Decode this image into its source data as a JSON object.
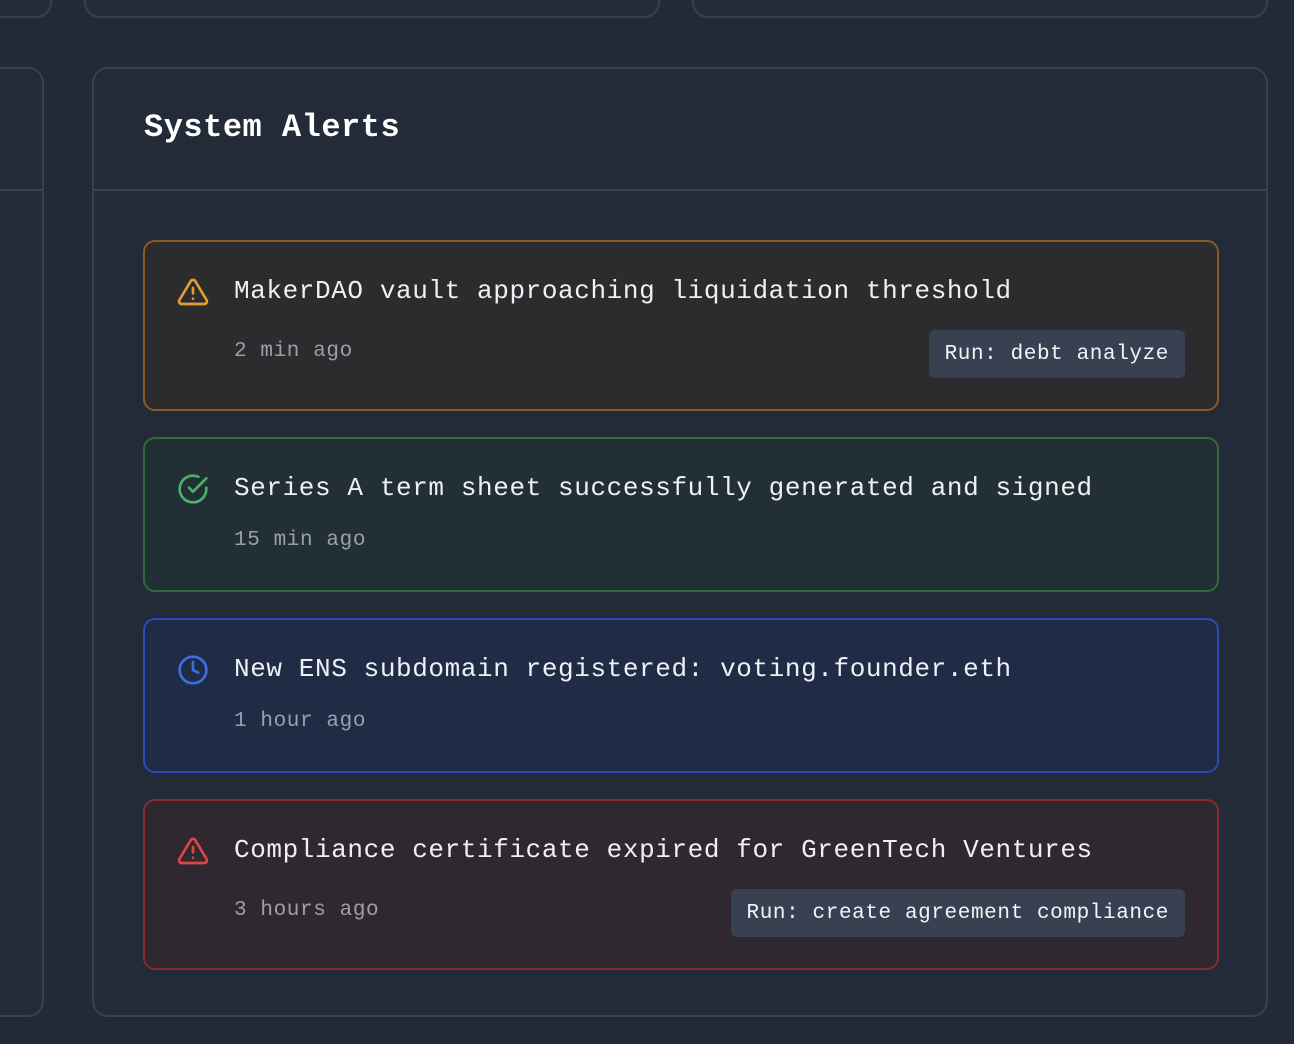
{
  "panel": {
    "title": "System Alerts"
  },
  "alerts": [
    {
      "type": "warning",
      "icon": "warning-triangle-icon",
      "color": "#e0a030",
      "message": "MakerDAO vault approaching liquidation threshold",
      "time": "2 min ago",
      "action": "Run: debt analyze"
    },
    {
      "type": "success",
      "icon": "check-circle-icon",
      "color": "#4caf6a",
      "message": "Series A term sheet successfully generated and signed",
      "time": "15 min ago"
    },
    {
      "type": "info",
      "icon": "clock-icon",
      "color": "#3b6fe0",
      "message": "New ENS subdomain registered: voting.founder.eth",
      "time": "1 hour ago"
    },
    {
      "type": "error",
      "icon": "alert-triangle-icon",
      "color": "#e04545",
      "message": "Compliance certificate expired for GreenTech Ventures",
      "time": "3 hours ago",
      "action": "Run: create agreement compliance"
    }
  ]
}
